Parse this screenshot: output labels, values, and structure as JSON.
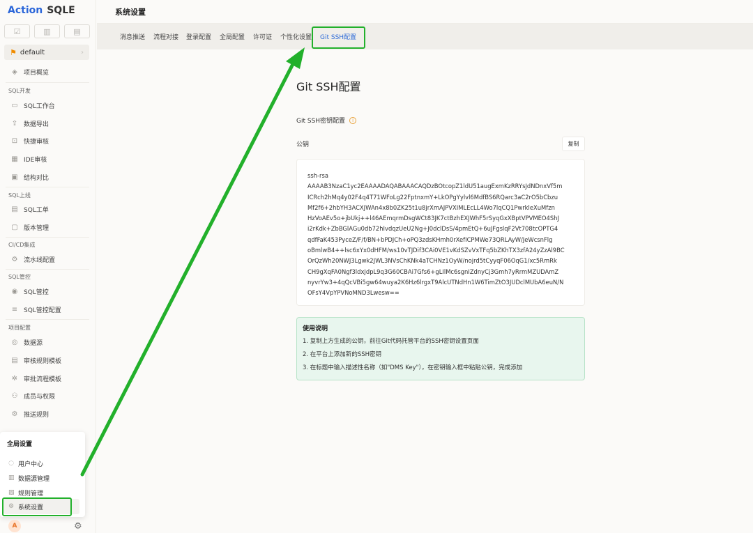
{
  "sidebar": {
    "logo_a": "Action",
    "logo_b": "SQLE",
    "project": "default",
    "overview": "项目概览",
    "groups": {
      "sql_dev": "SQL开发",
      "sql_online": "SQL上线",
      "cicd": "CI/CD集成",
      "sql_control": "SQL管控",
      "project_config": "项目配置"
    },
    "items": {
      "workbench": "SQL工作台",
      "export": "数据导出",
      "quick_audit": "快捷审核",
      "ide_audit": "IDE审核",
      "struct_compare": "结构对比",
      "sql_ticket": "SQL工单",
      "version_mgmt": "版本管理",
      "pipeline": "流水线配置",
      "sql_control": "SQL管控",
      "sql_control_config": "SQL管控配置",
      "datasource": "数据源",
      "rule_template": "审核规则模板",
      "approval_template": "审批流程模板",
      "members": "成员与权限",
      "push_rules": "推送规则"
    },
    "global_menu": {
      "title": "全局设置",
      "user_center": "用户中心",
      "datasource_mgmt": "数据源管理",
      "rule_mgmt": "规则管理",
      "system_settings": "系统设置"
    },
    "avatar": "A"
  },
  "header": {
    "title": "系统设置"
  },
  "tabs": [
    "消息推送",
    "流程对接",
    "登录配置",
    "全局配置",
    "许可证",
    "个性化设置",
    "Git SSH配置"
  ],
  "main": {
    "title": "Git SSH配置",
    "key_label": "Git SSH密钥配置",
    "pubkey_label": "公钥",
    "copy_label": "复制",
    "key_lines": [
      "ssh-rsa",
      "AAAAB3NzaC1yc2EAAAADAQABAAACAQDzBOtcopZ1ldU51augExmKzRRYsJdNDnxVf5m",
      "ICRch2hMq4y02F4q4T71WFoLg22FptnxmY+LkOPgYylvl6MdfBS6RQarc3aC2rO5bCbzu",
      "Mf2f6+2hbYH3ACXJWAn4x8b0ZK25t1u8jrXmAJPVXIMLEcLL4Wo7lqCQ1PwrkleXuMfzn",
      "HzVoAEv5o+jbUkj++l46AEmqrmDsgWCt83JK7ctBzhEXJWhF5rSyqGxXBptVPVMEO4ShJ",
      "i2rKdk+ZbBGlAGu0db72hIvdqzUeU2Ng+J0dclDsS/4pmEtQ+6uJFgslqF2Vt708tcOPTG4",
      "qdfFaK453PyceZ/F/f/BN+bPDJCh+oPQ3zdsKHmh0rXefICPMWe73QRLAyW/JeWcsnFlg",
      "oBmlwB4++lsc6xYx0dHFM/ws10vTJDif3CAi0VE1vKdSZvVxTFq5bZKhTX3zfA24yZzAl9BC",
      "OrQzWh20NWJ3Lgwk2JWL3NVsChKNk4aTCHNz1OyW/nojrd5tCyyqF06OqG1/xc5RmRk",
      "CH9gXqFA0Ngf3ldxJdpL9q3G60CBAi7Gfs6+gLIlMc6sgnIZdnyCj3Gmh7yRrmMZUDAmZ",
      "nyvrYw3+4qQcVBi5gw64wuya2K6Hz6lrgxT9AlcUTNdHn1W6TimZtO3JUDclMUbA6euN/N",
      "OFsY4VpYPVNoMND3Lwesw=="
    ],
    "usage": {
      "title": "使用说明",
      "steps": [
        "1. 复制上方生成的公钥，前往Git代码托管平台的SSH密钥设置页面",
        "2. 在平台上添加新的SSH密钥",
        "3. 在标题中输入描述性名称（如\"DMS Key\"），在密钥输入框中粘贴公钥，完成添加"
      ]
    }
  },
  "colors": {
    "accent": "#2f6cd8",
    "annotation": "#22b02b",
    "usage_bg": "#e8f6ee"
  }
}
